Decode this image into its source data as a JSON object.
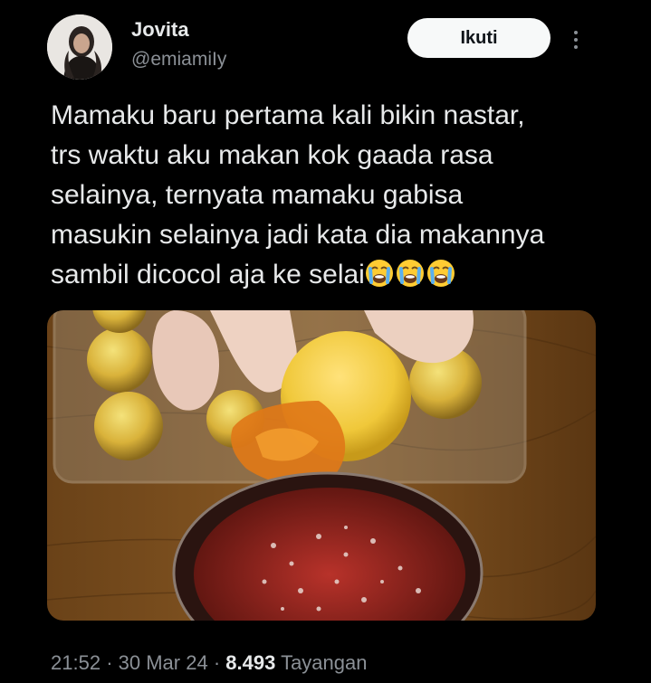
{
  "author": {
    "display_name": "Jovita",
    "handle": "@emiamiIy",
    "avatar_icon": "user-avatar-photo"
  },
  "follow_button": {
    "label": "Ikuti"
  },
  "more_menu": {
    "icon": "more-vertical-icon"
  },
  "tweet": {
    "lines": [
      "Mamaku baru pertama kali bikin nastar,",
      "trs waktu aku makan kok gaada rasa",
      "selainya, ternyata mamaku gabisa",
      "masukin selainya jadi kata dia makannya",
      "sambil dicocol aja ke selai"
    ],
    "emoji": [
      "loudly-crying-face",
      "loudly-crying-face",
      "loudly-crying-face"
    ]
  },
  "media": {
    "description_icon": "photo-nastar-dipped-in-jam"
  },
  "meta": {
    "time": "21:52",
    "sep1": "·",
    "date": "30 Mar 24",
    "sep2": "·",
    "views_count": "8.493",
    "views_label": "Tayangan"
  },
  "colors": {
    "background": "#000000",
    "text_primary": "#e7e9ea",
    "text_secondary": "#8b9096",
    "button_bg": "#f7f9f9",
    "button_text": "#0f1419"
  }
}
